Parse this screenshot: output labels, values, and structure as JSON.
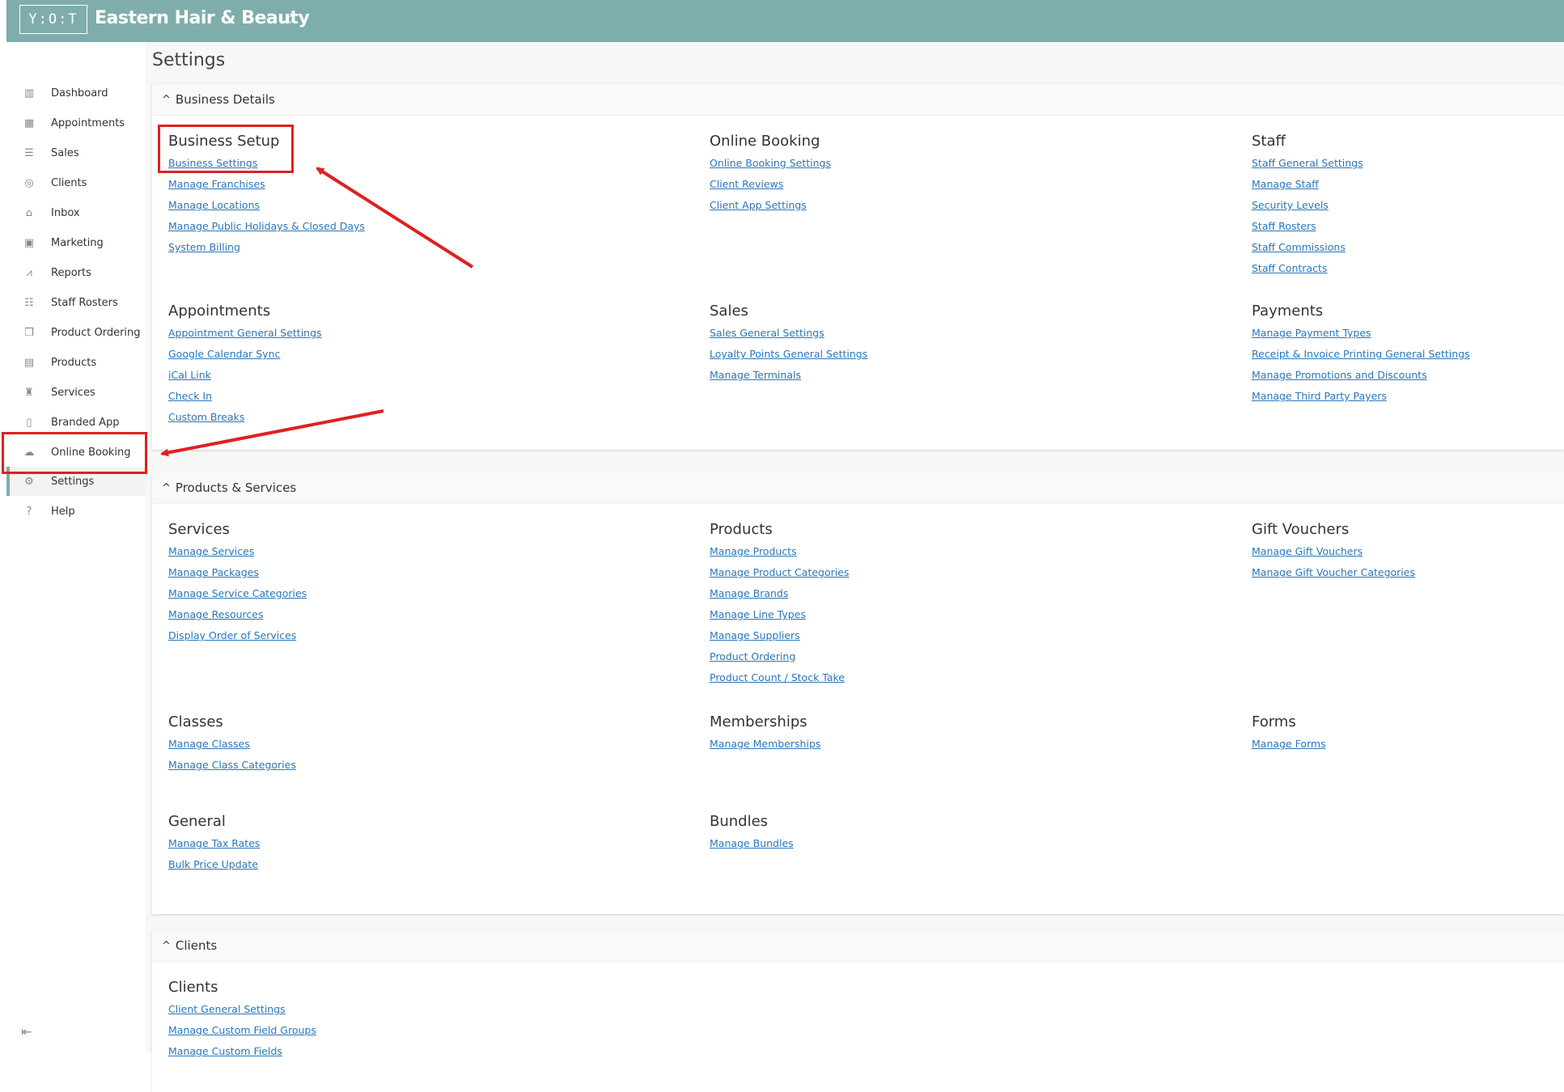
{
  "app": {
    "logo": "Y:O:T",
    "business_name": "Eastern Hair & Beauty"
  },
  "sidebar": {
    "items": [
      {
        "label": "Dashboard",
        "icon": "chart-icon",
        "glyph": "▥"
      },
      {
        "label": "Appointments",
        "icon": "calendar-icon",
        "glyph": "▦"
      },
      {
        "label": "Sales",
        "icon": "receipt-icon",
        "glyph": "☰"
      },
      {
        "label": "Clients",
        "icon": "user-circle-icon",
        "glyph": "◎"
      },
      {
        "label": "Inbox",
        "icon": "inbox-icon",
        "glyph": "⌂"
      },
      {
        "label": "Marketing",
        "icon": "newspaper-icon",
        "glyph": "▣"
      },
      {
        "label": "Reports",
        "icon": "line-chart-icon",
        "glyph": "⩘"
      },
      {
        "label": "Staff Rosters",
        "icon": "people-icon",
        "glyph": "☷"
      },
      {
        "label": "Product Ordering",
        "icon": "gift-icon",
        "glyph": "❒"
      },
      {
        "label": "Products",
        "icon": "boxes-icon",
        "glyph": "▤"
      },
      {
        "label": "Services",
        "icon": "chair-icon",
        "glyph": "♜"
      },
      {
        "label": "Branded App",
        "icon": "phone-icon",
        "glyph": "▯"
      },
      {
        "label": "Online Booking",
        "icon": "cloud-icon",
        "glyph": "☁"
      },
      {
        "label": "Settings",
        "icon": "gear-icon",
        "glyph": "⚙"
      },
      {
        "label": "Help",
        "icon": "lightbulb-icon",
        "glyph": "?"
      }
    ],
    "active": "Settings",
    "collapse_glyph": "⇤"
  },
  "page": {
    "title": "Settings"
  },
  "sections": [
    {
      "title": "Business Details",
      "groups": [
        {
          "title": "Business Setup",
          "links": [
            "Business Settings",
            "Manage Franchises",
            "Manage Locations",
            "Manage Public Holidays & Closed Days",
            "System Billing"
          ]
        },
        {
          "title": "Online Booking",
          "links": [
            "Online Booking Settings",
            "Client Reviews",
            "Client App Settings"
          ]
        },
        {
          "title": "Staff",
          "links": [
            "Staff General Settings",
            "Manage Staff",
            "Security Levels",
            "Staff Rosters",
            "Staff Commissions",
            "Staff Contracts"
          ]
        },
        {
          "title": "Appointments",
          "links": [
            "Appointment General Settings",
            "Google Calendar Sync",
            "iCal Link",
            "Check In",
            "Custom Breaks"
          ]
        },
        {
          "title": "Sales",
          "links": [
            "Sales General Settings",
            "Loyalty Points General Settings",
            "Manage Terminals"
          ]
        },
        {
          "title": "Payments",
          "links": [
            "Manage Payment Types",
            "Receipt & Invoice Printing General Settings",
            "Manage Promotions and Discounts",
            "Manage Third Party Payers"
          ]
        }
      ]
    },
    {
      "title": "Products & Services",
      "groups": [
        {
          "title": "Services",
          "links": [
            "Manage Services",
            "Manage Packages",
            "Manage Service Categories",
            "Manage Resources",
            "Display Order of Services"
          ]
        },
        {
          "title": "Products",
          "links": [
            "Manage Products",
            "Manage Product Categories",
            "Manage Brands",
            "Manage Line Types",
            "Manage Suppliers",
            "Product Ordering",
            "Product Count / Stock Take"
          ]
        },
        {
          "title": "Gift Vouchers",
          "links": [
            "Manage Gift Vouchers",
            "Manage Gift Voucher Categories"
          ]
        },
        {
          "title": "Classes",
          "links": [
            "Manage Classes",
            "Manage Class Categories"
          ]
        },
        {
          "title": "Memberships",
          "links": [
            "Manage Memberships"
          ]
        },
        {
          "title": "Forms",
          "links": [
            "Manage Forms"
          ]
        },
        {
          "title": "General",
          "links": [
            "Manage Tax Rates",
            "Bulk Price Update"
          ]
        },
        {
          "title": "Bundles",
          "links": [
            "Manage Bundles"
          ]
        }
      ]
    },
    {
      "title": "Clients",
      "groups": [
        {
          "title": "Clients",
          "links": [
            "Client General Settings",
            "Manage Custom Field Groups",
            "Manage Custom Fields"
          ]
        }
      ]
    }
  ],
  "colors": {
    "header": "#7fadab",
    "link": "#2a76b8",
    "annotation": "#e02020"
  }
}
